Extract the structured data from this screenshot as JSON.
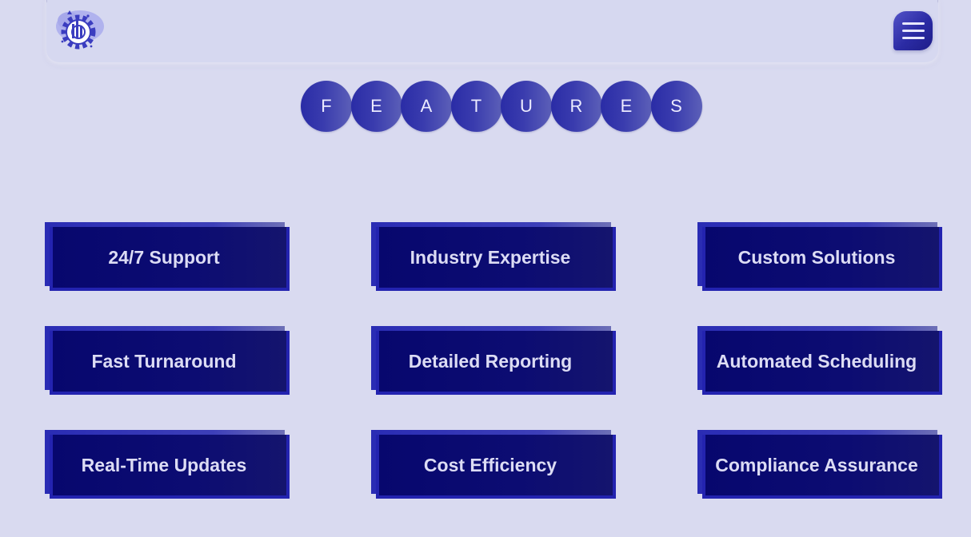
{
  "header": {
    "logo_icon": "gear-industry-logo-icon",
    "menu_icon": "hamburger-menu-icon"
  },
  "title": {
    "letters": [
      "F",
      "E",
      "A",
      "T",
      "U",
      "R",
      "E",
      "S"
    ]
  },
  "features": [
    {
      "label": "24/7 Support"
    },
    {
      "label": "Industry Expertise"
    },
    {
      "label": "Custom Solutions"
    },
    {
      "label": "Fast Turnaround"
    },
    {
      "label": "Detailed Reporting"
    },
    {
      "label": "Automated Scheduling"
    },
    {
      "label": "Real-Time Updates"
    },
    {
      "label": "Cost Efficiency"
    },
    {
      "label": "Compliance Assurance"
    }
  ],
  "colors": {
    "background": "#d9daf0",
    "card_dark": "#07076e",
    "card_border": "#2323b0",
    "accent": "#2a2ca6",
    "text_light": "#dcdcf4"
  }
}
